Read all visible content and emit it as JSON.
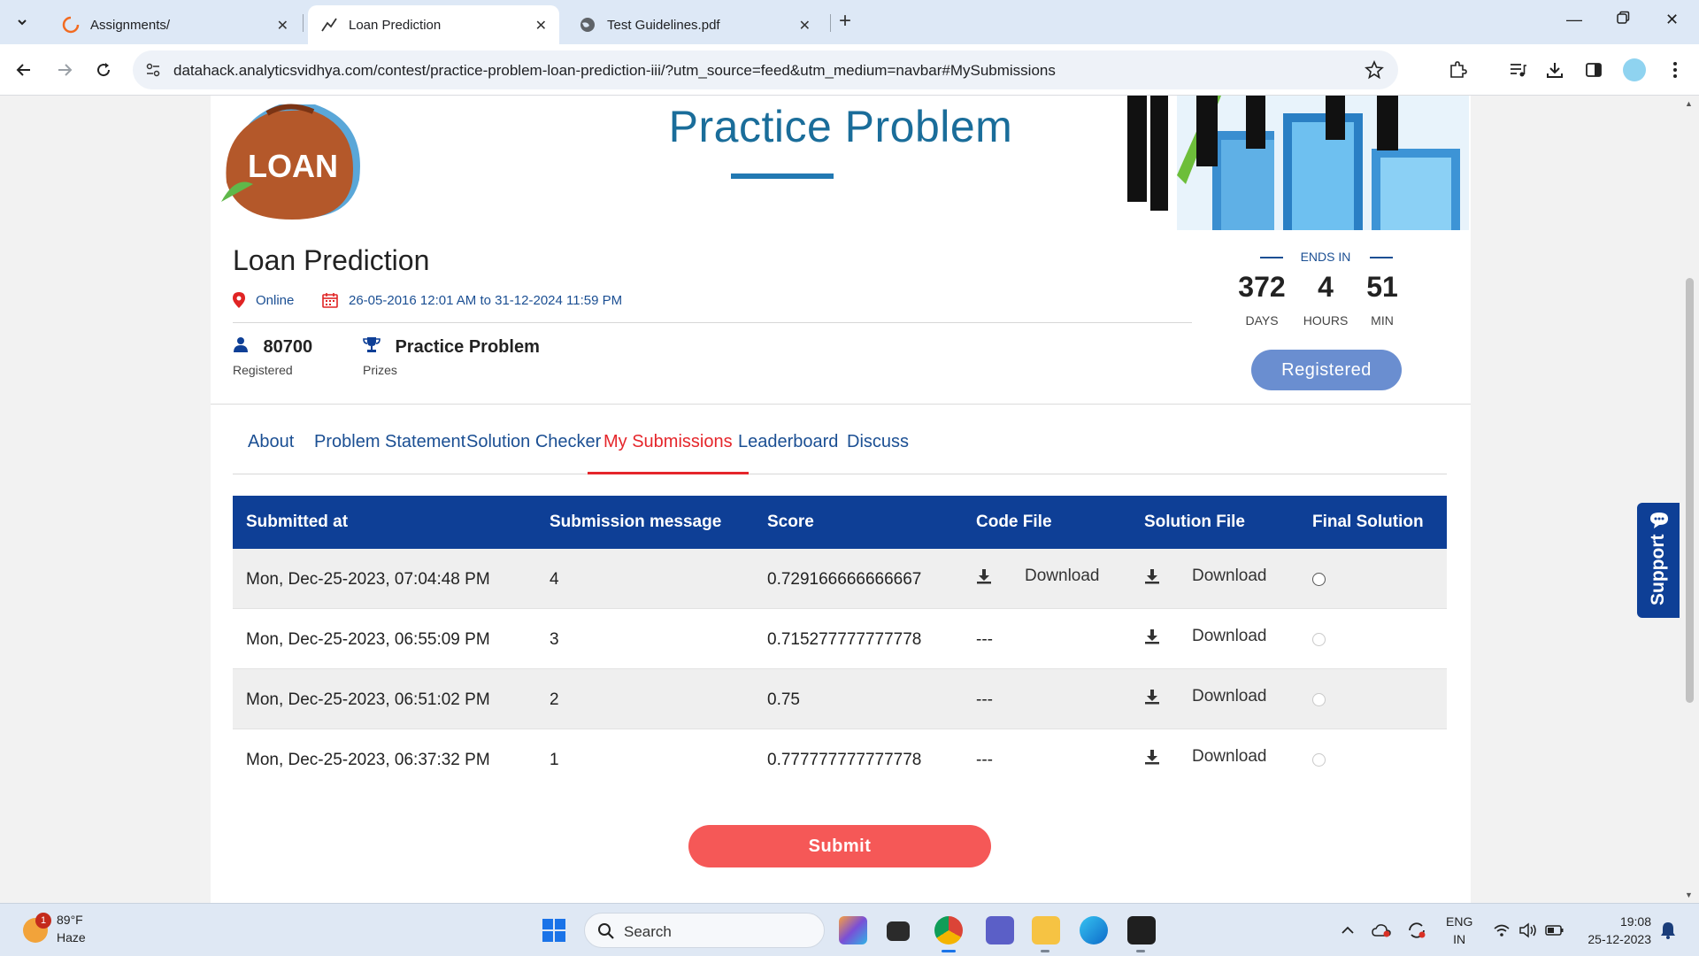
{
  "browser": {
    "tabs": [
      {
        "title": "Assignments/",
        "active": false
      },
      {
        "title": "Loan Prediction",
        "active": true
      },
      {
        "title": "Test Guidelines.pdf",
        "active": false
      }
    ],
    "url": "datahack.analyticsvidhya.com/contest/practice-problem-loan-prediction-iii/?utm_source=feed&utm_medium=navbar#MySubmissions"
  },
  "banner": {
    "bag_label": "LOAN",
    "title": "Practice Problem"
  },
  "contest": {
    "title": "Loan Prediction",
    "location": "Online",
    "dates": "26-05-2016 12:01 AM to 31-12-2024 11:59 PM",
    "registered_count": "80700",
    "registered_label": "Registered",
    "prize": "Practice Problem",
    "prize_label": "Prizes"
  },
  "countdown": {
    "label": "ENDS IN",
    "days": "372",
    "days_label": "DAYS",
    "hours": "4",
    "hours_label": "HOURS",
    "min": "51",
    "min_label": "MIN",
    "status_button": "Registered"
  },
  "nav_tabs": [
    "About",
    "Problem Statement",
    "Solution Checker",
    "My Submissions",
    "Leaderboard",
    "Discuss"
  ],
  "active_tab": "My Submissions",
  "table": {
    "headers": [
      "Submitted at",
      "Submission message",
      "Score",
      "Code File",
      "Solution File",
      "Final Solution"
    ],
    "rows": [
      {
        "submitted_at": "Mon, Dec-25-2023, 07:04:48 PM",
        "message": "4",
        "score": "0.729166666666667",
        "code_file": "Download",
        "solution_file": "Download",
        "final_enabled": true
      },
      {
        "submitted_at": "Mon, Dec-25-2023, 06:55:09 PM",
        "message": "3",
        "score": "0.715277777777778",
        "code_file": "---",
        "solution_file": "Download",
        "final_enabled": false
      },
      {
        "submitted_at": "Mon, Dec-25-2023, 06:51:02 PM",
        "message": "2",
        "score": "0.75",
        "code_file": "---",
        "solution_file": "Download",
        "final_enabled": false
      },
      {
        "submitted_at": "Mon, Dec-25-2023, 06:37:32 PM",
        "message": "1",
        "score": "0.777777777777778",
        "code_file": "---",
        "solution_file": "Download",
        "final_enabled": false
      }
    ]
  },
  "submit_button": "Submit",
  "support_label": "Support",
  "taskbar": {
    "weather_badge": "1",
    "weather_temp": "89°F",
    "weather_desc": "Haze",
    "search_label": "Search",
    "lang_line1": "ENG",
    "lang_line2": "IN",
    "time": "19:08",
    "date": "25-12-2023"
  },
  "colors": {
    "brand_blue": "#0e3f96",
    "link_blue": "#1b4f93",
    "active_tab_red": "#e5262b",
    "submit_red": "#f55857",
    "registered_blue": "#6a8ed0"
  }
}
